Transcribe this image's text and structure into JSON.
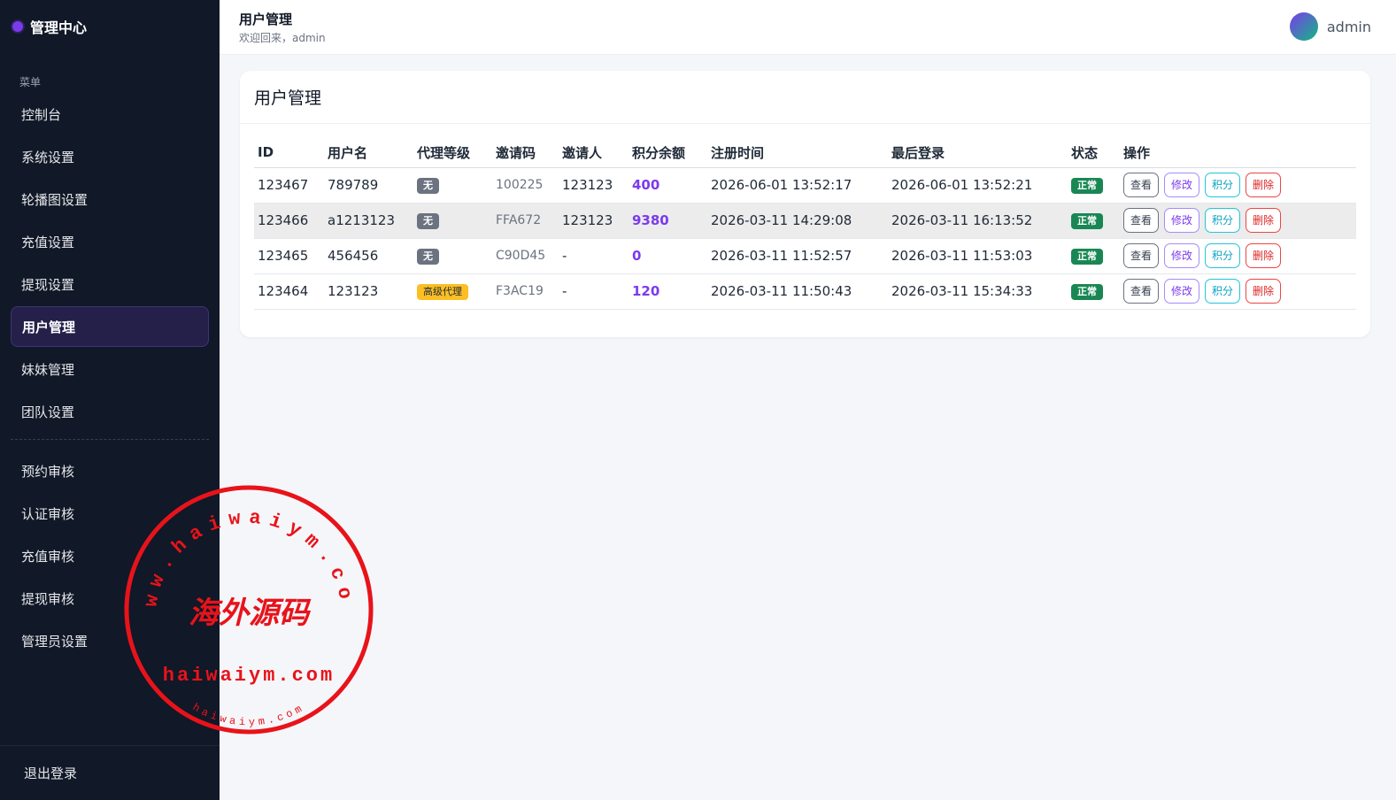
{
  "sidebar": {
    "brand": "管理中心",
    "caption": "菜单",
    "items": [
      {
        "label": "控制台"
      },
      {
        "label": "系统设置"
      },
      {
        "label": "轮播图设置"
      },
      {
        "label": "充值设置"
      },
      {
        "label": "提现设置"
      },
      {
        "label": "用户管理",
        "active": true
      },
      {
        "label": "妹妹管理"
      },
      {
        "label": "团队设置"
      }
    ],
    "items2": [
      {
        "label": "预约审核"
      },
      {
        "label": "认证审核"
      },
      {
        "label": "充值审核"
      },
      {
        "label": "提现审核"
      },
      {
        "label": "管理员设置"
      }
    ],
    "logout": "退出登录"
  },
  "topbar": {
    "title": "用户管理",
    "subtitle": "欢迎回来，admin",
    "username": "admin"
  },
  "card": {
    "title": "用户管理",
    "columns": [
      "ID",
      "用户名",
      "代理等级",
      "邀请码",
      "邀请人",
      "积分余额",
      "注册时间",
      "最后登录",
      "状态",
      "操作"
    ],
    "rows": [
      {
        "id": "123467",
        "username": "789789",
        "level": "无",
        "invite_code": "100225",
        "inviter": "123123",
        "points": "400",
        "registered": "2026-06-01 13:52:17",
        "last_login": "2026-06-01 13:52:21",
        "status": "正常"
      },
      {
        "id": "123466",
        "username": "a1213123",
        "level": "无",
        "invite_code": "FFA672",
        "inviter": "123123",
        "points": "9380",
        "registered": "2026-03-11 14:29:08",
        "last_login": "2026-03-11 16:13:52",
        "status": "正常"
      },
      {
        "id": "123465",
        "username": "456456",
        "level": "无",
        "invite_code": "C90D45",
        "inviter": "-",
        "points": "0",
        "registered": "2026-03-11 11:52:57",
        "last_login": "2026-03-11 11:53:03",
        "status": "正常"
      },
      {
        "id": "123464",
        "username": "123123",
        "level": "高级代理",
        "invite_code": "F3AC19",
        "inviter": "-",
        "points": "120",
        "registered": "2026-03-11 11:50:43",
        "last_login": "2026-03-11 15:34:33",
        "status": "正常"
      }
    ],
    "actions": {
      "view": "查看",
      "edit": "修改",
      "points": "积分",
      "delete": "删除"
    }
  },
  "watermark": {
    "top_text": "www.haiwaiym.com",
    "center_text": "海外源码",
    "bottom_text": "haiwaiym.com",
    "small_text": "haiwaiym.com",
    "color": "#e8131a"
  },
  "colors": {
    "sidebar_bg": "#111827",
    "accent": "#7c3aed",
    "status_ok": "#198754",
    "senior_badge": "#fbbf24"
  }
}
